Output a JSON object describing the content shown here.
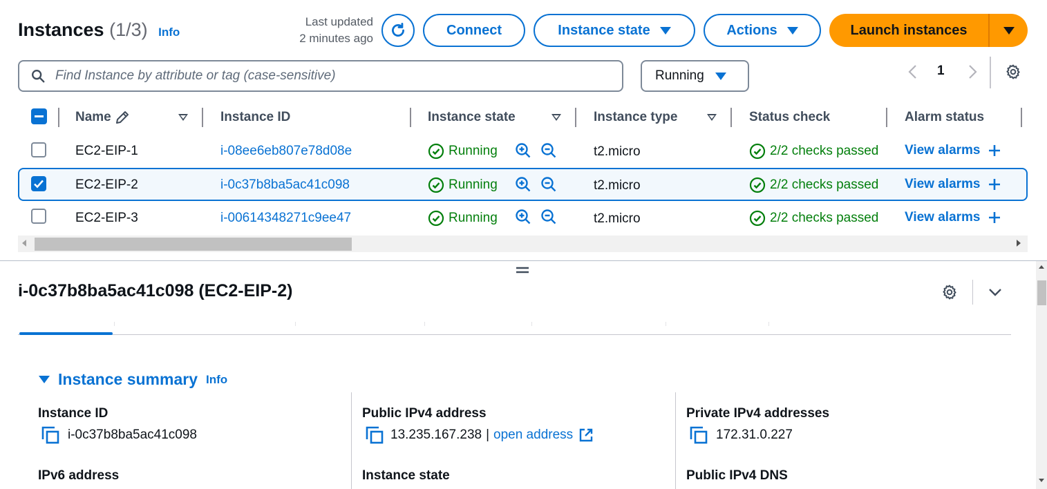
{
  "header": {
    "title": "Instances",
    "count": "(1/3)",
    "info": "Info",
    "last_updated_line1": "Last updated",
    "last_updated_line2": "2 minutes ago"
  },
  "toolbar": {
    "connect": "Connect",
    "instance_state": "Instance state",
    "actions": "Actions",
    "launch": "Launch instances"
  },
  "search": {
    "placeholder": "Find Instance by attribute or tag (case-sensitive)",
    "filter_value": "Running"
  },
  "pagination": {
    "page": "1"
  },
  "table": {
    "columns": [
      "Name",
      "Instance ID",
      "Instance state",
      "Instance type",
      "Status check",
      "Alarm status"
    ],
    "rows": [
      {
        "name": "EC2-EIP-1",
        "id": "i-08ee6eb807e78d08e",
        "state": "Running",
        "type": "t2.micro",
        "status": "2/2 checks passed",
        "alarm": "View alarms",
        "selected": false
      },
      {
        "name": "EC2-EIP-2",
        "id": "i-0c37b8ba5ac41c098",
        "state": "Running",
        "type": "t2.micro",
        "status": "2/2 checks passed",
        "alarm": "View alarms",
        "selected": true
      },
      {
        "name": "EC2-EIP-3",
        "id": "i-00614348271c9ee47",
        "state": "Running",
        "type": "t2.micro",
        "status": "2/2 checks passed",
        "alarm": "View alarms",
        "selected": false
      }
    ]
  },
  "detail": {
    "title": "i-0c37b8ba5ac41c098 (EC2-EIP-2)",
    "summary_title": "Instance summary",
    "summary_info": "Info",
    "fields": {
      "instance_id_label": "Instance ID",
      "instance_id_value": "i-0c37b8ba5ac41c098",
      "public_ipv4_label": "Public IPv4 address",
      "public_ipv4_value": "13.235.167.238",
      "public_ipv4_sep": "|",
      "open_address": "open address",
      "private_ipv4_label": "Private IPv4 addresses",
      "private_ipv4_value": "172.31.0.227",
      "ipv6_label": "IPv6 address",
      "instance_state_label": "Instance state",
      "public_dns_label": "Public IPv4 DNS"
    }
  },
  "colors": {
    "link": "#0972d3",
    "success": "#037f0c",
    "primary": "#ff9900",
    "text": "#0f141a"
  }
}
